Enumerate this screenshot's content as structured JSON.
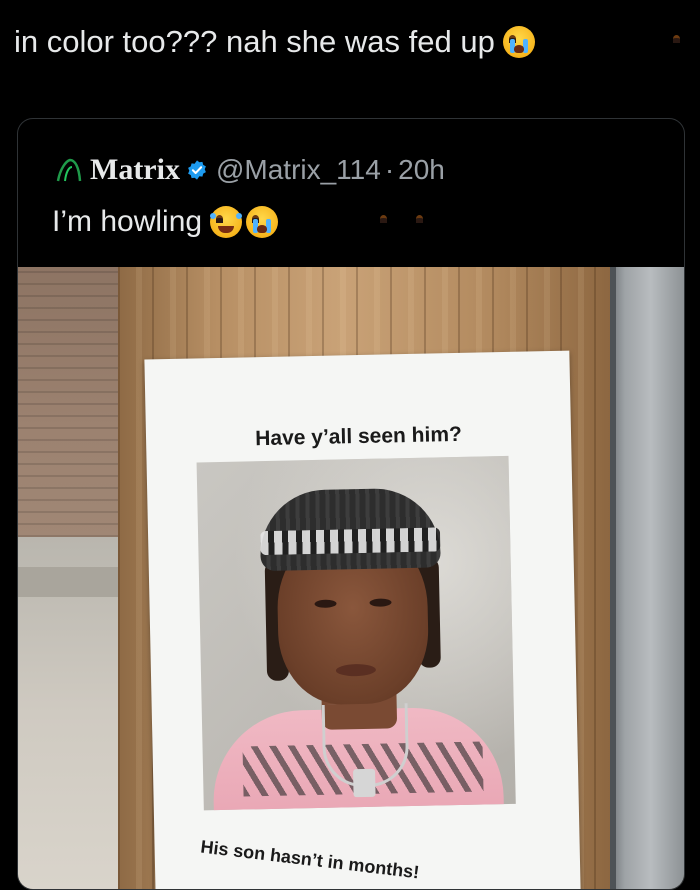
{
  "tweet": {
    "text": "in color too??? nah she was fed up",
    "emoji": "loudly-crying-face"
  },
  "quoted_tweet": {
    "display_name": "Matrix",
    "verified": true,
    "handle": "@Matrix_114",
    "separator": "·",
    "time": "20h",
    "text": "I’m howling",
    "emojis": [
      "face-with-tears-of-joy",
      "loudly-crying-face"
    ]
  },
  "photo": {
    "flyer_title": "Have y’all seen him?",
    "flyer_caption": "His son hasn’t in months!"
  },
  "colors": {
    "background": "#000000",
    "text": "#e7e9ea",
    "muted": "#9aa0a6",
    "verified_blue": "#1d9bf0",
    "card_border": "#2f3336"
  }
}
